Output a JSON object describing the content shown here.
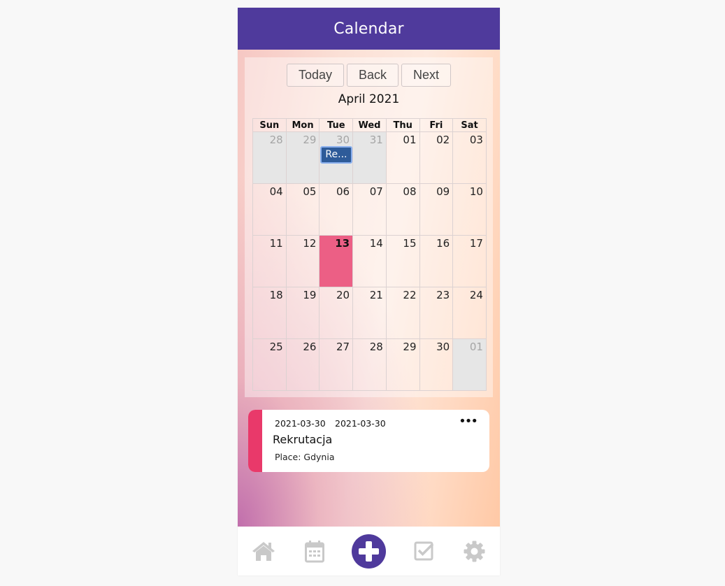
{
  "header": {
    "title": "Calendar"
  },
  "toolbar": {
    "today": "Today",
    "back": "Back",
    "next": "Next"
  },
  "calendar": {
    "month_label": "April 2021",
    "weekdays": [
      "Sun",
      "Mon",
      "Tue",
      "Wed",
      "Thu",
      "Fri",
      "Sat"
    ],
    "weeks": [
      [
        "28",
        "29",
        "30",
        "31",
        "01",
        "02",
        "03"
      ],
      [
        "04",
        "05",
        "06",
        "07",
        "08",
        "09",
        "10"
      ],
      [
        "11",
        "12",
        "13",
        "14",
        "15",
        "16",
        "17"
      ],
      [
        "18",
        "19",
        "20",
        "21",
        "22",
        "23",
        "24"
      ],
      [
        "25",
        "26",
        "27",
        "28",
        "29",
        "30",
        "01"
      ]
    ],
    "event_chip": "Re..."
  },
  "event": {
    "start_date": "2021-03-30",
    "end_date": "2021-03-30",
    "more": "•••",
    "title": "Rekrutacja",
    "place": "Place: Gdynia"
  },
  "colors": {
    "primary": "#4f3a9c",
    "today_highlight": "#ec5f85",
    "event_stripe": "#e9396a",
    "event_chip": "#2e5b99",
    "nav_icon": "#c9c9c9"
  },
  "nav": {
    "icons": [
      "home-icon",
      "calendar-icon",
      "plus-icon",
      "checkbox-icon",
      "gear-icon"
    ]
  }
}
